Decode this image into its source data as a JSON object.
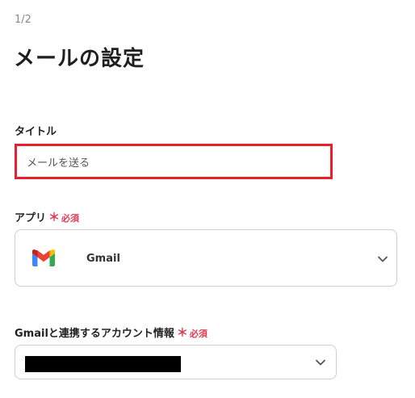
{
  "step_indicator": "1/2",
  "page_title": "メールの設定",
  "title_field": {
    "label": "タイトル",
    "value": "メールを送る"
  },
  "app_field": {
    "label": "アプリ",
    "required_mark": "＊",
    "required_text": "必須",
    "selected_app": "Gmail",
    "icon": "gmail-icon"
  },
  "account_field": {
    "label": "Gmailと連携するアカウント情報",
    "required_mark": "＊",
    "required_text": "必須"
  },
  "colors": {
    "highlight": "#e8202e",
    "required": "#e03b53"
  }
}
